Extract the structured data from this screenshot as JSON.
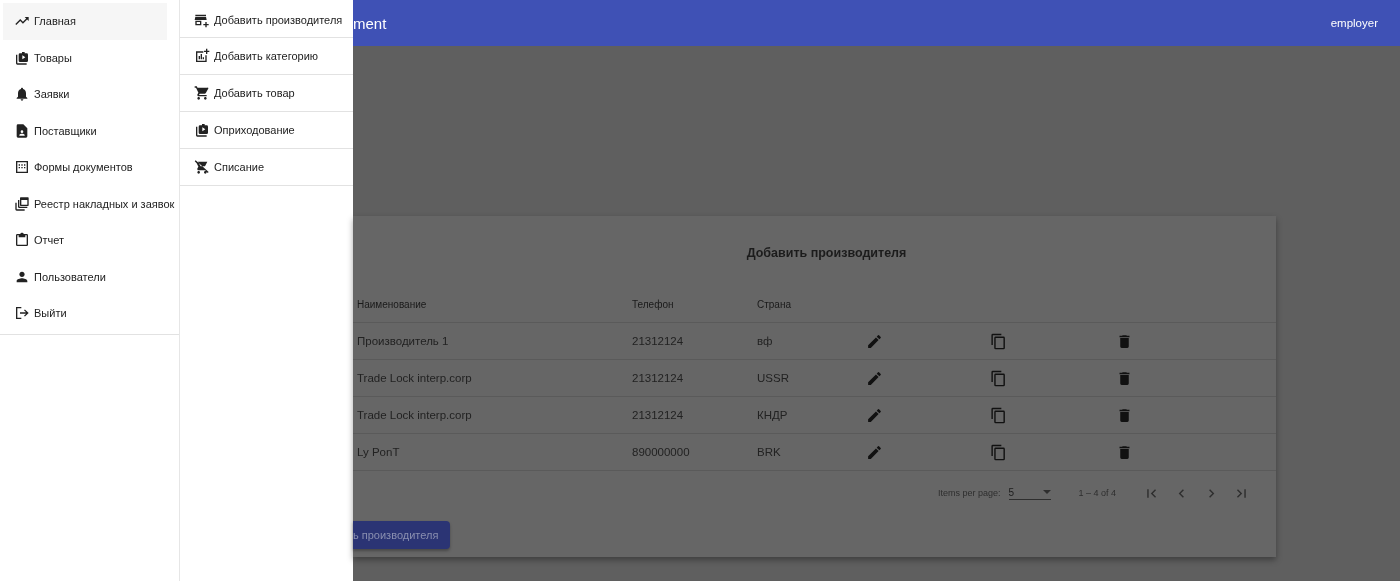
{
  "sidebar": {
    "items": [
      {
        "label": "Главная",
        "selected": true
      },
      {
        "label": "Товары",
        "selected": false
      },
      {
        "label": "Заявки",
        "selected": false
      },
      {
        "label": "Поставщики",
        "selected": false
      },
      {
        "label": "Формы документов",
        "selected": false
      },
      {
        "label": "Реестр накладных и заявок",
        "selected": false
      },
      {
        "label": "Отчет",
        "selected": false
      },
      {
        "label": "Пользователи",
        "selected": false
      },
      {
        "label": "Выйти",
        "selected": false
      }
    ]
  },
  "submenu": {
    "items": [
      {
        "label": "Добавить производителя"
      },
      {
        "label": "Добавить категорию"
      },
      {
        "label": "Добавить товар"
      },
      {
        "label": "Оприходование"
      },
      {
        "label": "Списание"
      }
    ]
  },
  "toolbar": {
    "title": "ment",
    "user": "employer"
  },
  "card": {
    "title": "Добавить производителя",
    "columns": [
      "Наименование",
      "Телефон",
      "Страна"
    ],
    "rows": [
      {
        "name": "Производитель 1",
        "phone": "21312124",
        "country": "вф"
      },
      {
        "name": "Trade Lock interp.corp",
        "phone": "21312124",
        "country": "USSR"
      },
      {
        "name": "Trade Lock interp.corp",
        "phone": "21312124",
        "country": "КНДР"
      },
      {
        "name": "Ly PonT",
        "phone": "890000000",
        "country": "BRK"
      }
    ],
    "paginator": {
      "label": "Items per page:",
      "page_size": "5",
      "range": "1 – 4 of 4"
    },
    "button": "ь производителя"
  }
}
